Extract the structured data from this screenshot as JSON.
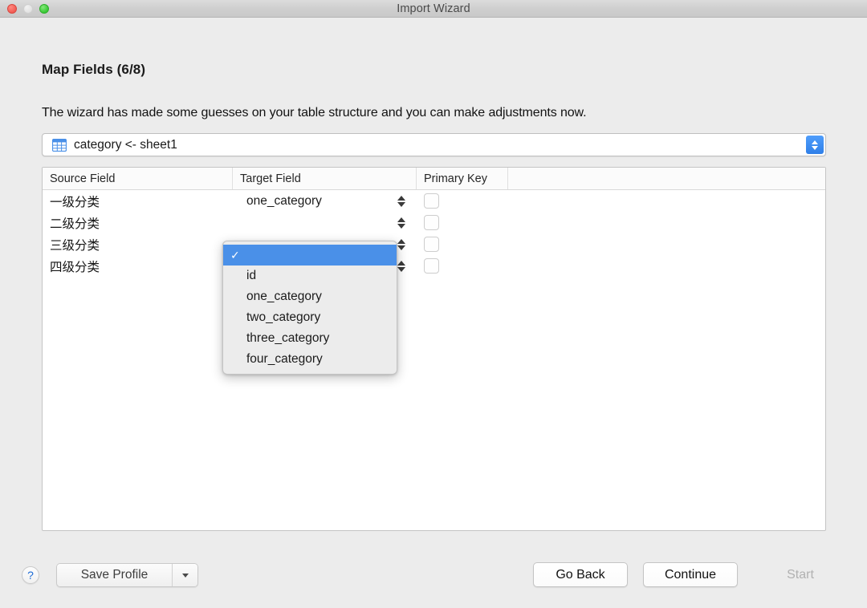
{
  "window": {
    "title": "Import Wizard",
    "traffic_lights": [
      "close",
      "minimize",
      "maximize"
    ]
  },
  "step": {
    "title": "Map Fields (6/8)",
    "description": "The wizard has made some guesses on your table structure and you can make adjustments now."
  },
  "table_selector": {
    "icon": "table-grid-icon",
    "value": "category <- sheet1",
    "stepper": "up-down-stepper-icon"
  },
  "map_table": {
    "columns": [
      "Source Field",
      "Target Field",
      "Primary Key"
    ],
    "rows": [
      {
        "source": "一级分类",
        "target": "one_category",
        "primary_key": false
      },
      {
        "source": "二级分类",
        "target": "",
        "primary_key": false
      },
      {
        "source": "三级分类",
        "target": "",
        "primary_key": false
      },
      {
        "source": "四级分类",
        "target": "",
        "primary_key": false
      }
    ]
  },
  "dropdown_menu": {
    "open": true,
    "selected_index": 0,
    "items": [
      {
        "label": "",
        "checked": true
      },
      {
        "label": "id",
        "checked": false
      },
      {
        "label": "one_category",
        "checked": false
      },
      {
        "label": "two_category",
        "checked": false
      },
      {
        "label": "three_category",
        "checked": false
      },
      {
        "label": "four_category",
        "checked": false
      }
    ]
  },
  "footer": {
    "help_label": "?",
    "save_profile_label": "Save Profile",
    "go_back_label": "Go Back",
    "continue_label": "Continue",
    "start_label": "Start",
    "start_disabled": true
  },
  "colors": {
    "accent_blue": "#4a90e8",
    "stepper_blue": "#2f7fe8",
    "window_bg": "#ececec",
    "help_blue": "#1c6bd6"
  }
}
